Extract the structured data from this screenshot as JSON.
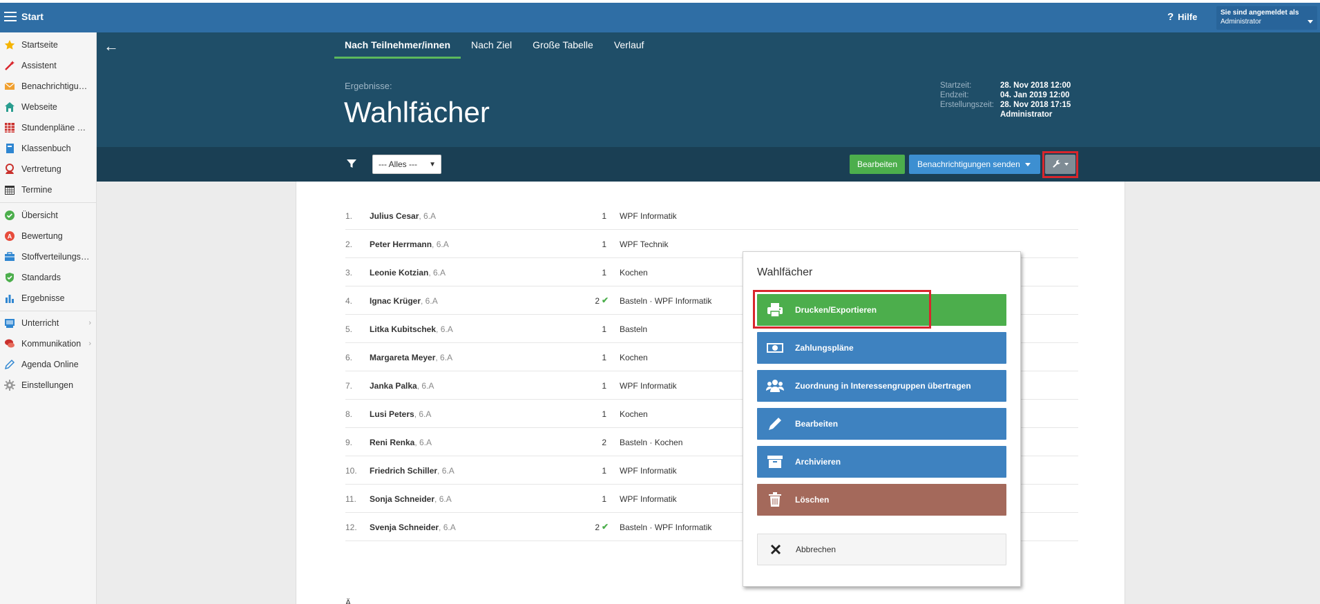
{
  "topbar": {
    "title": "Start",
    "help": "Hilfe",
    "user_line1": "Sie sind angemeldet als",
    "user_line2": "Administrator"
  },
  "sidebar": {
    "items": [
      {
        "label": "Startseite",
        "icon": "star-icon"
      },
      {
        "label": "Assistent",
        "icon": "wand-icon"
      },
      {
        "label": "Benachrichtigungen",
        "icon": "envelope-icon"
      },
      {
        "label": "Webseite",
        "icon": "home-icon"
      },
      {
        "label": "Stundenpläne und Räume",
        "icon": "timetable-icon"
      },
      {
        "label": "Klassenbuch",
        "icon": "book-icon"
      },
      {
        "label": "Vertretung",
        "icon": "person-icon"
      },
      {
        "label": "Termine",
        "icon": "calendar-icon"
      },
      {
        "label": "Übersicht",
        "icon": "check-circle-icon"
      },
      {
        "label": "Bewertung",
        "icon": "rating-icon"
      },
      {
        "label": "Stoffverteilungspläne",
        "icon": "briefcase-icon"
      },
      {
        "label": "Standards",
        "icon": "shield-icon"
      },
      {
        "label": "Ergebnisse",
        "icon": "bar-chart-icon"
      },
      {
        "label": "Unterricht",
        "icon": "classroom-icon"
      },
      {
        "label": "Kommunikation",
        "icon": "chat-icon"
      },
      {
        "label": "Agenda Online",
        "icon": "pen-icon"
      },
      {
        "label": "Einstellungen",
        "icon": "gear-icon"
      }
    ]
  },
  "header": {
    "tabs": [
      "Nach Teilnehmer/innen",
      "Nach Ziel",
      "Große Tabelle",
      "Verlauf"
    ],
    "label": "Ergebnisse:",
    "title": "Wahlfächer",
    "meta": {
      "start_key": "Startzeit:",
      "start_val": "28. Nov 2018 12:00",
      "end_key": "Endzeit:",
      "end_val": "04. Jan 2019 12:00",
      "created_key": "Erstellungszeit:",
      "created_val": "28. Nov 2018 17:15",
      "created_by": "Administrator"
    }
  },
  "toolbar": {
    "filter_value": "--- Alles ---",
    "edit_label": "Bearbeiten",
    "notify_label": "Benachrichtigungen senden"
  },
  "rows": [
    {
      "num": "1.",
      "name": "Julius Cesar",
      "cls": ", 6.A",
      "count": "1",
      "check": "",
      "subjects": "WPF Informatik"
    },
    {
      "num": "2.",
      "name": "Peter Herrmann",
      "cls": ", 6.A",
      "count": "1",
      "check": "",
      "subjects": "WPF Technik"
    },
    {
      "num": "3.",
      "name": "Leonie Kotzian",
      "cls": ", 6.A",
      "count": "1",
      "check": "",
      "subjects": "Kochen"
    },
    {
      "num": "4.",
      "name": "Ignac Krüger",
      "cls": ", 6.A",
      "count": "2",
      "check": "✔",
      "subjects": "Basteln · WPF Informatik"
    },
    {
      "num": "5.",
      "name": "Litka Kubitschek",
      "cls": ", 6.A",
      "count": "1",
      "check": "",
      "subjects": "Basteln"
    },
    {
      "num": "6.",
      "name": "Margareta Meyer",
      "cls": ", 6.A",
      "count": "1",
      "check": "",
      "subjects": "Kochen"
    },
    {
      "num": "7.",
      "name": "Janka Palka",
      "cls": ", 6.A",
      "count": "1",
      "check": "",
      "subjects": "WPF Informatik"
    },
    {
      "num": "8.",
      "name": "Lusi Peters",
      "cls": ", 6.A",
      "count": "1",
      "check": "",
      "subjects": "Kochen"
    },
    {
      "num": "9.",
      "name": "Reni Renka",
      "cls": ", 6.A",
      "count": "2",
      "check": "",
      "subjects": "Basteln · Kochen"
    },
    {
      "num": "10.",
      "name": "Friedrich Schiller",
      "cls": ", 6.A",
      "count": "1",
      "check": "",
      "subjects": "WPF Informatik"
    },
    {
      "num": "11.",
      "name": "Sonja Schneider",
      "cls": ", 6.A",
      "count": "1",
      "check": "",
      "subjects": "WPF Informatik"
    },
    {
      "num": "12.",
      "name": "Svenja Schneider",
      "cls": ", 6.A",
      "count": "2",
      "check": "✔",
      "subjects": "Basteln · WPF Informatik"
    }
  ],
  "bottom_text": "Ä...",
  "popup": {
    "title": "Wahlfächer",
    "print": "Drucken/Exportieren",
    "payment": "Zahlungspläne",
    "assign": "Zuordnung in Interessengruppen übertragen",
    "edit": "Bearbeiten",
    "archive": "Archivieren",
    "delete": "Löschen",
    "cancel": "Abbrechen"
  },
  "colors": {
    "topbar": "#2f6ea5",
    "header": "#1f4e68",
    "toolbar": "#1a3f54",
    "green": "#4cae4c",
    "blue": "#3e82c0",
    "red": "#a4695b",
    "highlight": "#d9262c"
  }
}
